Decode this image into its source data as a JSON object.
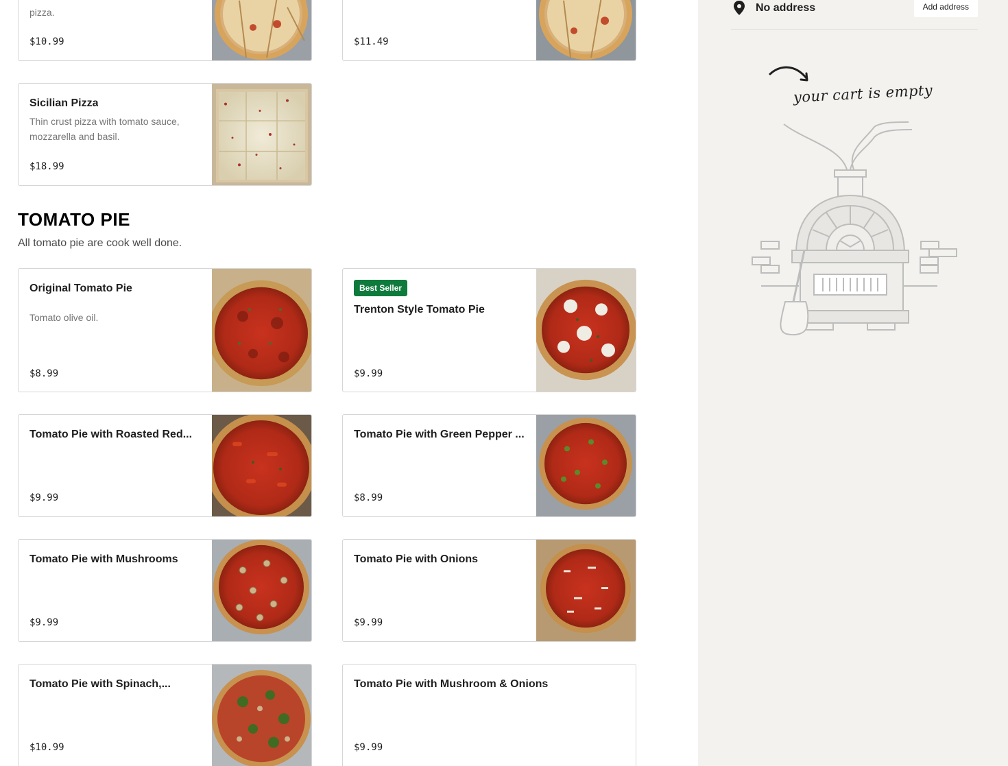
{
  "colors": {
    "badge_bg": "#0e7a3c",
    "sidebar_bg": "#f3f2ef",
    "card_border": "#d6d6d6"
  },
  "top_cards": [
    {
      "desc_tail": "pizza.",
      "price": "$10.99"
    },
    {
      "price": "$11.49"
    }
  ],
  "sicilian": {
    "name": "Sicilian Pizza",
    "desc": "Thin crust pizza with tomato sauce, mozzarella and basil.",
    "price": "$18.99"
  },
  "section": {
    "title": "TOMATO PIE",
    "description": "All tomato pie are cook well done."
  },
  "items": [
    {
      "name": "Original Tomato Pie",
      "desc": "Tomato olive oil.",
      "price": "$8.99"
    },
    {
      "badge": "Best Seller",
      "name": "Trenton Style Tomato Pie",
      "price": "$9.99"
    },
    {
      "name": "Tomato Pie with Roasted Red...",
      "price": "$9.99"
    },
    {
      "name": "Tomato Pie with Green Pepper ...",
      "price": "$8.99"
    },
    {
      "name": "Tomato Pie with Mushrooms",
      "price": "$9.99"
    },
    {
      "name": "Tomato Pie with Onions",
      "price": "$9.99"
    },
    {
      "name": "Tomato Pie with Spinach,...",
      "price": "$10.99"
    },
    {
      "name": "Tomato Pie with Mushroom & Onions",
      "price": "$9.99"
    }
  ],
  "cart": {
    "address": "No address",
    "add_address_label": "Add address",
    "empty_message": "your cart is empty"
  },
  "icons": {
    "location": "location-pin-icon",
    "arrow": "curved-arrow-icon",
    "oven": "pizza-oven-illustration"
  }
}
